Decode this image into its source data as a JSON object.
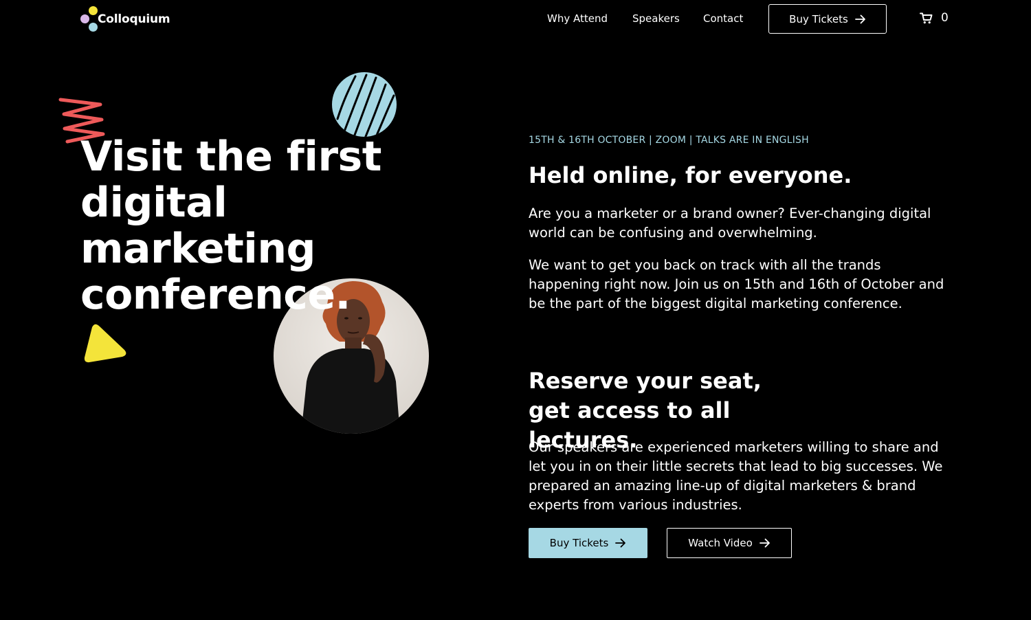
{
  "brand": {
    "name": "Colloquium",
    "dot_colors": [
      "#f4e43a",
      "#d9b8e8",
      "#a6d8e4"
    ]
  },
  "nav": {
    "links": [
      "Why Attend",
      "Speakers",
      "Contact"
    ],
    "buy_label": "Buy Tickets",
    "cart_icon": "cart-icon",
    "cart_count": "0"
  },
  "hero": {
    "title_lines": [
      "Visit the first",
      "digital marketing",
      "conference."
    ]
  },
  "info": {
    "eyebrow": "15TH & 16TH OCTOBER | ZOOM | TALKS ARE IN ENGLISH",
    "heading": "Held online, for everyone.",
    "paragraph1": "Are you a marketer or a brand owner? Ever-changing digital world can be confusing and overwhelming.",
    "paragraph2": "We want to get you back on track with all the trands happening right now. Join us on  15th and 16th of October and be the part of the biggest digital marketing conference.",
    "heading2": "Reserve your seat, get access to all lectures.",
    "paragraph3": "Our speakers are experienced marketers willing to share and let you in on their little secrets that lead to big successes. We prepared an amazing line-up of digital marketers & brand experts from various industries."
  },
  "cta": {
    "primary_label": "Buy Tickets",
    "secondary_label": "Watch Video"
  },
  "colors": {
    "accent_blue": "#a6d8e4",
    "accent_yellow": "#f4e43a",
    "accent_red": "#ee5a5a",
    "background": "#000000"
  }
}
